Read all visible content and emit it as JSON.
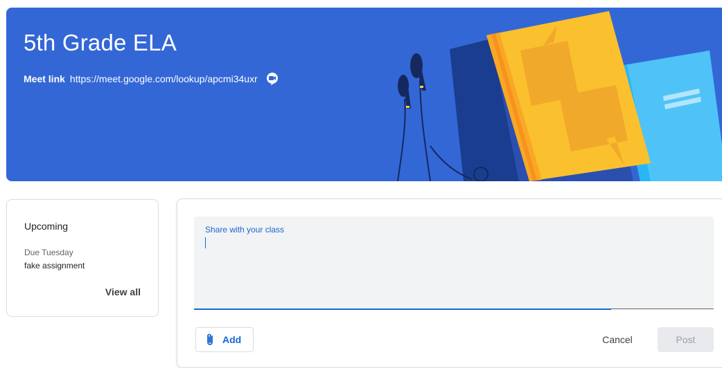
{
  "banner": {
    "title": "5th Grade ELA",
    "meet_label": "Meet link",
    "meet_url": "https://meet.google.com/lookup/apcmi34uxr",
    "meet_icon": "video-camera-icon",
    "background_color": "#3367d6"
  },
  "upcoming": {
    "title": "Upcoming",
    "due_label": "Due Tuesday",
    "assignment": "fake assignment",
    "view_all": "View all"
  },
  "composer": {
    "placeholder": "Share with your class",
    "add_label": "Add",
    "add_icon": "paperclip-icon",
    "cancel_label": "Cancel",
    "post_label": "Post",
    "accent_color": "#1967d2"
  }
}
